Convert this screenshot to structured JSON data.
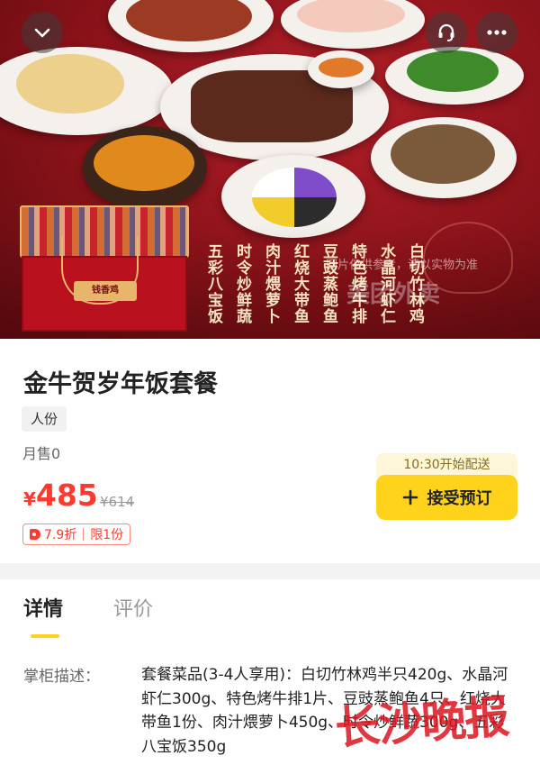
{
  "hero": {
    "dish_names": [
      "白切竹林鸡",
      "水晶河虾仁",
      "特色烤牛排",
      "豆豉蒸鲍鱼",
      "红烧大带鱼",
      "肉汁煨萝卜",
      "时令炒鲜蔬",
      "五彩八宝饭"
    ],
    "watermark_note": "图片仅供参考，请以实物为准",
    "watermark_logo": "美团外卖",
    "giftbox_brand": "钱香鸡"
  },
  "top_bar": {
    "back_icon": "chevron-down-icon",
    "service_icon": "customer-service-icon",
    "more_icon": "more-dots-icon"
  },
  "product": {
    "title": "金牛贺岁年饭套餐",
    "spec_tag": "人份",
    "monthly_sales": "月售0",
    "currency": "¥",
    "price": "485",
    "original_price": "¥614",
    "discount": "7.9折",
    "limit": "限1份"
  },
  "order": {
    "delivery_note": "10:30开始配送",
    "button_label": "接受预订"
  },
  "tabs": [
    {
      "label": "详情",
      "active": true
    },
    {
      "label": "评价",
      "active": false
    }
  ],
  "details": {
    "label": "掌柜描述：",
    "text": "套餐菜品(3-4人享用)：白切竹林鸡半只420g、水晶河虾仁300g、特色烤牛排1片、豆豉蒸鲍鱼4只、红烧大带鱼1份、肉汁煨萝卜450g、时令炒鲜蔬300g、五彩八宝饭350g"
  },
  "stamp_text": "长沙晚报",
  "colors": {
    "accent": "#ffd21c",
    "price": "#ff3b30",
    "hero_bg": "#8a1219"
  }
}
